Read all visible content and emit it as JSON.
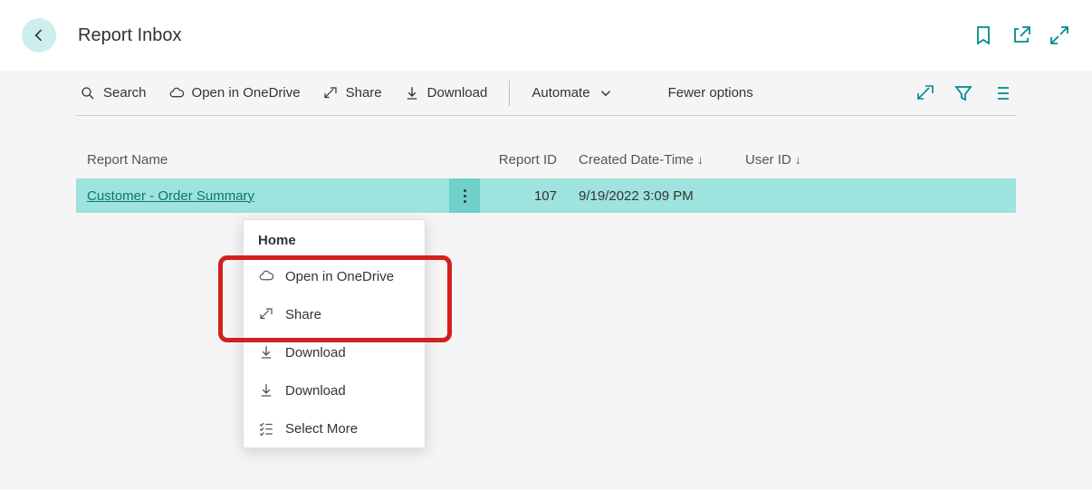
{
  "header": {
    "title": "Report Inbox"
  },
  "toolbar": {
    "search": "Search",
    "open_onedrive": "Open in OneDrive",
    "share": "Share",
    "download": "Download",
    "automate": "Automate",
    "fewer_options": "Fewer options"
  },
  "table": {
    "headers": {
      "name": "Report Name",
      "id": "Report ID",
      "date": "Created Date-Time",
      "user": "User ID"
    },
    "rows": [
      {
        "name": "Customer - Order Summary",
        "id": "107",
        "date": "9/19/2022 3:09 PM",
        "user": ""
      }
    ]
  },
  "context_menu": {
    "header": "Home",
    "items": {
      "open_onedrive": "Open in OneDrive",
      "share": "Share",
      "download1": "Download",
      "download2": "Download",
      "select_more": "Select More"
    }
  }
}
